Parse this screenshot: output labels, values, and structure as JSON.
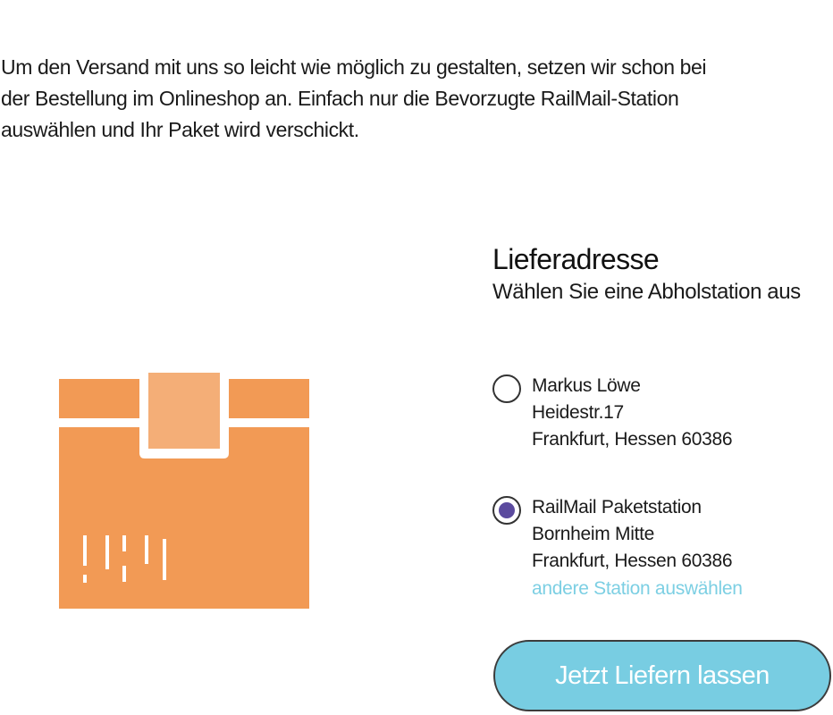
{
  "intro": {
    "text": "Um den Versand mit uns so leicht wie möglich zu gestalten, setzen wir schon bei\nder Bestellung im Onlineshop an.  Einfach nur die Bevorzugte RailMail-Station\nauswählen und Ihr Paket wird verschickt."
  },
  "illustration": {
    "icon": "package-box-icon",
    "colors": {
      "box": "#f29a55",
      "flap": "#f4ae77",
      "lines": "#ffffff"
    }
  },
  "delivery": {
    "title": "Lieferadresse",
    "subtitle": "Wählen Sie eine Abholstation aus",
    "options": [
      {
        "selected": false,
        "line1": "Markus Löwe",
        "line2": "Heidestr.17",
        "line3": "Frankfurt, Hessen 60386"
      },
      {
        "selected": true,
        "line1": "RailMail Paketstation",
        "line2": "Bornheim Mitte",
        "line3": "Frankfurt, Hessen 60386"
      }
    ],
    "other_station_link": "andere Station auswählen",
    "submit_label": "Jetzt Liefern lassen"
  },
  "colors": {
    "accent": "#78cde2",
    "radio_selected": "#5b4a9e",
    "link": "#7ccfe3"
  }
}
